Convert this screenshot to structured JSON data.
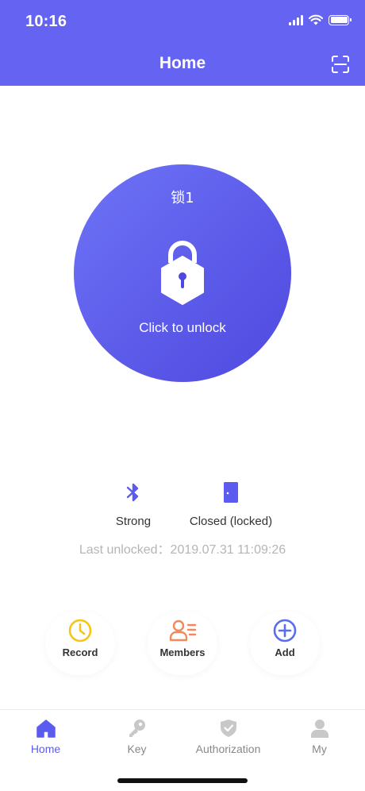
{
  "status_bar": {
    "time": "10:16"
  },
  "header": {
    "title": "Home",
    "scan_icon": "scan-icon"
  },
  "lock": {
    "name": "锁1",
    "action_label": "Click to unlock",
    "icon": "padlock-icon"
  },
  "status": {
    "bluetooth": {
      "icon": "bluetooth-icon",
      "label": "Strong"
    },
    "door": {
      "icon": "door-icon",
      "label": "Closed (locked)"
    },
    "last_unlocked": "Last unlocked：2019.07.31 11:09:26"
  },
  "actions": [
    {
      "label": "Record",
      "icon": "clock-icon",
      "color": "#F5C518"
    },
    {
      "label": "Members",
      "icon": "members-icon",
      "color": "#F08A5D"
    },
    {
      "label": "Add",
      "icon": "plus-circle-icon",
      "color": "#5B6CF0"
    }
  ],
  "tabs": [
    {
      "label": "Home",
      "icon": "home-icon",
      "active": true
    },
    {
      "label": "Key",
      "icon": "key-icon",
      "active": false
    },
    {
      "label": "Authorization",
      "icon": "shield-check-icon",
      "active": false
    },
    {
      "label": "My",
      "icon": "person-icon",
      "active": false
    }
  ],
  "colors": {
    "primary": "#6463F2",
    "active_tab": "#5B5BF0",
    "muted": "#B5B5B5"
  }
}
